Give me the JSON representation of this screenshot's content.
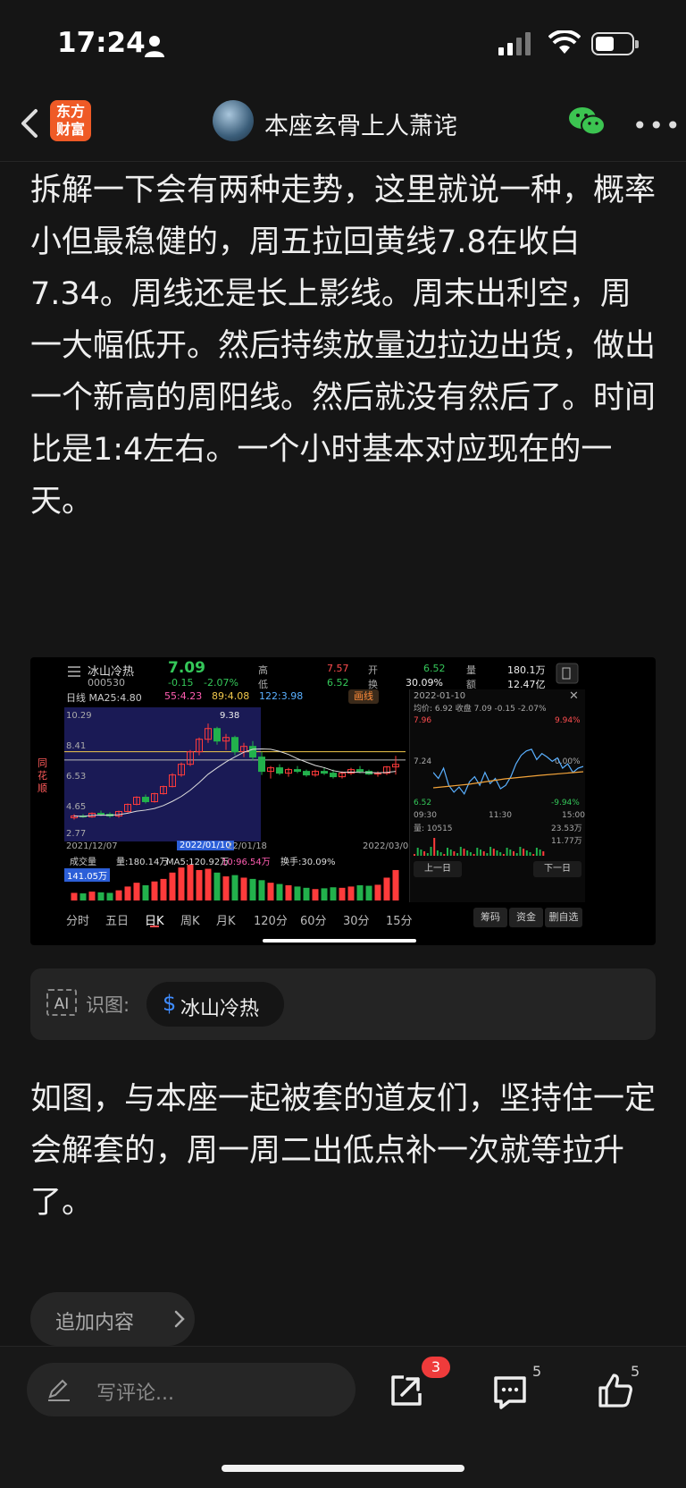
{
  "status": {
    "time": "17:24"
  },
  "header": {
    "logo_line1": "东方",
    "logo_line2": "财富",
    "username": "本座玄骨上人萧诧"
  },
  "post": {
    "paragraph1": "拆解一下会有两种走势，这里就说一种，概率小但最稳健的，周五拉回黄线7.8在收白7.34。周线还是长上影线。周末出利空，周一大幅低开。然后持续放量边拉边出货，做出一个新高的周阳线。然后就没有然后了。时间比是1:4左右。一个小时基本对应现在的一天。",
    "paragraph2": "如图，与本座一起被套的道友们，坚持住一定会解套的，周一周二出低点补一次就等拉升了。"
  },
  "embedded_chart": {
    "stock_name": "冰山冷热",
    "stock_code": "000530",
    "price": "7.09",
    "change": "-0.15",
    "change_pct": "-2.07%",
    "high_label": "高",
    "high": "7.57",
    "low_label": "低",
    "low": "6.52",
    "open_label": "开",
    "open": "6.52",
    "turnover_label": "换",
    "turnover": "30.09%",
    "volume_label": "量",
    "volume": "180.1万",
    "amount_label": "额",
    "amount": "12.47亿",
    "ma_line": "日线  MA25:4.80",
    "ma_b": "55:4.23",
    "ma_c": "89:4.08",
    "ma_d": "122:3.98",
    "draw_btn": "画线",
    "y_top": "10.29",
    "y_2": "8.41",
    "y_3": "6.53",
    "y_4": "4.65",
    "y_5": "2.77",
    "peak": "9.38",
    "date_start": "2021/12/07",
    "date_sel": "2022/01/10",
    "date_mid": "22/01/18",
    "date_end": "2022/03/07",
    "vol_label": "成交量",
    "vol_val": "量:180.14万",
    "vol_ma5": "MA5:120.92万",
    "vol_ma10": "10:96.54万",
    "vol_turn": "换手:30.09%",
    "vol_max": "141.05万",
    "side_brand": "同花顺",
    "mini_date": "2022-01-10",
    "mini_info": "均价: 6.92 收盘 7.09 -0.15 -2.07%",
    "mini_hi": "7.96",
    "mini_hi_pct": "9.94%",
    "mini_mid": "7.24",
    "mini_mid_pct": "0.00%",
    "mini_lo": "6.52",
    "mini_lo_pct": "-9.94%",
    "mini_t1": "09:30",
    "mini_t2": "11:30",
    "mini_t3": "15:00",
    "mini_vol": "量: 10515",
    "mini_v1": "23.53万",
    "mini_v2": "11.77万",
    "prev_day": "上一日",
    "next_day": "下一日",
    "tabs": [
      "分时",
      "五日",
      "日K",
      "周K",
      "月K",
      "120分",
      "60分",
      "30分",
      "15分"
    ],
    "btn_chips": "筹码",
    "btn_funds": "资金",
    "btn_del": "删自选"
  },
  "ocr": {
    "label": "识图:",
    "chip": "冰山冷热"
  },
  "actions": {
    "add_content": "追加内容"
  },
  "bottom": {
    "comment_placeholder": "写评论...",
    "share_badge": "3",
    "comment_count": "5",
    "like_count": "5"
  },
  "chart_data": {
    "type": "candlestick",
    "title": "冰山冷热 日K",
    "x_range": [
      "2021/12/07",
      "2022/03/07"
    ],
    "ylim": [
      2.77,
      10.29
    ],
    "candles": [
      [
        4.1,
        4.3,
        4.0,
        4.2
      ],
      [
        4.2,
        4.3,
        4.1,
        4.15
      ],
      [
        4.15,
        4.4,
        4.1,
        4.35
      ],
      [
        4.35,
        4.5,
        4.2,
        4.3
      ],
      [
        4.3,
        4.4,
        4.1,
        4.2
      ],
      [
        4.2,
        4.5,
        4.1,
        4.45
      ],
      [
        4.45,
        4.9,
        4.4,
        4.85
      ],
      [
        4.85,
        5.3,
        4.8,
        5.25
      ],
      [
        5.25,
        5.4,
        4.9,
        5.0
      ],
      [
        5.0,
        5.5,
        4.95,
        5.45
      ],
      [
        5.45,
        5.9,
        5.4,
        5.85
      ],
      [
        5.85,
        6.6,
        5.8,
        6.5
      ],
      [
        6.5,
        7.2,
        6.4,
        7.1
      ],
      [
        7.1,
        7.9,
        7.0,
        7.8
      ],
      [
        7.8,
        8.6,
        7.6,
        8.5
      ],
      [
        8.5,
        9.38,
        8.3,
        9.1
      ],
      [
        9.1,
        9.2,
        8.2,
        8.4
      ],
      [
        8.4,
        8.8,
        7.9,
        8.6
      ],
      [
        8.6,
        8.7,
        7.6,
        7.8
      ],
      [
        7.8,
        8.3,
        7.5,
        8.1
      ],
      [
        8.1,
        8.4,
        7.3,
        7.5
      ],
      [
        7.5,
        7.8,
        6.5,
        6.7
      ],
      [
        6.7,
        7.0,
        6.3,
        6.9
      ],
      [
        6.9,
        7.1,
        6.5,
        6.6
      ],
      [
        6.6,
        6.9,
        6.4,
        6.8
      ],
      [
        6.8,
        7.0,
        6.6,
        6.7
      ],
      [
        6.7,
        6.8,
        6.4,
        6.5
      ],
      [
        6.5,
        6.8,
        6.4,
        6.7
      ],
      [
        6.7,
        6.9,
        6.5,
        6.6
      ],
      [
        6.6,
        6.8,
        6.3,
        6.4
      ],
      [
        6.4,
        6.7,
        6.3,
        6.6
      ],
      [
        6.6,
        6.9,
        6.5,
        6.8
      ],
      [
        6.8,
        7.0,
        6.6,
        6.7
      ],
      [
        6.7,
        6.8,
        6.5,
        6.55
      ],
      [
        6.55,
        6.7,
        6.4,
        6.6
      ],
      [
        6.6,
        7.0,
        6.5,
        6.95
      ],
      [
        6.95,
        7.57,
        6.52,
        7.09
      ]
    ],
    "volumes": [
      30,
      28,
      35,
      32,
      30,
      40,
      55,
      70,
      60,
      75,
      85,
      110,
      130,
      141,
      120,
      125,
      110,
      95,
      100,
      90,
      85,
      80,
      70,
      65,
      60,
      55,
      50,
      45,
      48,
      52,
      50,
      55,
      60,
      58,
      62,
      90,
      120
    ]
  }
}
